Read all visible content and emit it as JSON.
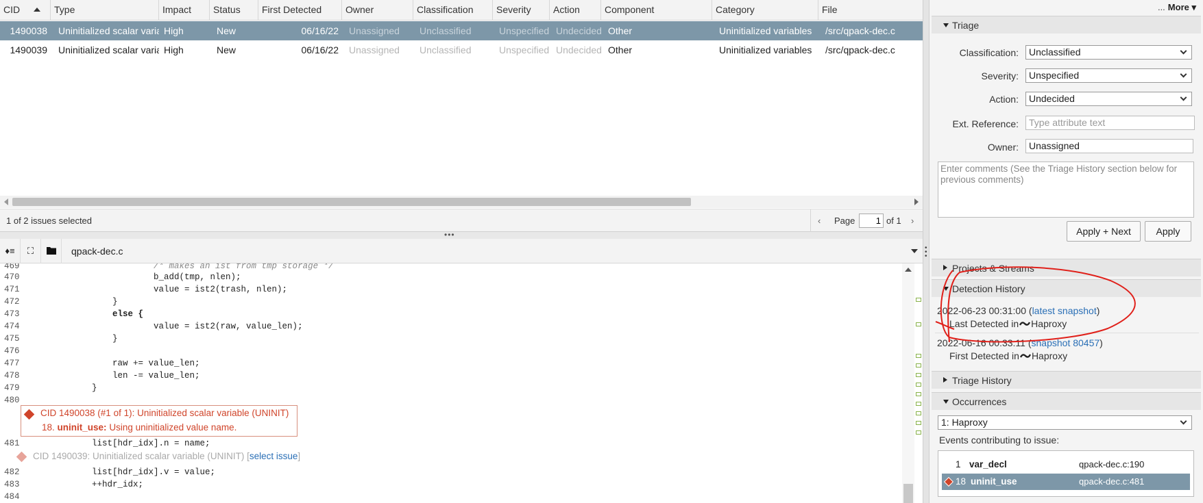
{
  "table": {
    "columns": [
      "CID",
      "Type",
      "Impact",
      "Status",
      "First Detected",
      "Owner",
      "Classification",
      "Severity",
      "Action",
      "Component",
      "Category",
      "File"
    ],
    "rows": [
      {
        "cid": "1490038",
        "type": "Uninitialized scalar variable",
        "impact": "High",
        "status": "New",
        "first_detected": "06/16/22",
        "owner": "Unassigned",
        "classification": "Unclassified",
        "severity": "Unspecified",
        "action": "Undecided",
        "component": "Other",
        "category": "Uninitialized variables",
        "file": "/src/qpack-dec.c"
      },
      {
        "cid": "1490039",
        "type": "Uninitialized scalar variable",
        "impact": "High",
        "status": "New",
        "first_detected": "06/16/22",
        "owner": "Unassigned",
        "classification": "Unclassified",
        "severity": "Unspecified",
        "action": "Undecided",
        "component": "Other",
        "category": "Uninitialized variables",
        "file": "/src/qpack-dec.c"
      }
    ],
    "selected_count": "1 of 2 issues selected",
    "pager": {
      "prev": "‹",
      "page_label": "Page",
      "page": "1",
      "of_label": "of 1",
      "next": "›"
    }
  },
  "file_bar": {
    "file_name": "qpack-dec.c"
  },
  "code": {
    "lines": [
      {
        "n": "469",
        "text": "                        /* makes an ist from tmp storage */"
      },
      {
        "n": "470",
        "text": "                        b_add(tmp, nlen);"
      },
      {
        "n": "471",
        "text": "                        value = ist2(trash, nlen);"
      },
      {
        "n": "472",
        "text": "                }"
      },
      {
        "n": "473",
        "text": "                else {"
      },
      {
        "n": "474",
        "text": "                        value = ist2(raw, value_len);"
      },
      {
        "n": "475",
        "text": "                }"
      },
      {
        "n": "476",
        "text": ""
      },
      {
        "n": "477",
        "text": "                raw += value_len;"
      },
      {
        "n": "478",
        "text": "                len -= value_len;"
      },
      {
        "n": "479",
        "text": "            }"
      },
      {
        "n": "480",
        "text": ""
      },
      {
        "n": "481",
        "text": "            list[hdr_idx].n = name;"
      },
      {
        "n": "482",
        "text": "            list[hdr_idx].v = value;"
      },
      {
        "n": "483",
        "text": "            ++hdr_idx;"
      },
      {
        "n": "484",
        "text": ""
      }
    ],
    "event": {
      "title": "CID 1490038 (#1 of 1): Uninitialized scalar variable (UNINIT)",
      "step": "18.",
      "event_name": "uninit_use:",
      "message": "Using uninitialized value name."
    },
    "other_issue": {
      "text": "CID 1490039: Uninitialized scalar variable (UNINIT) [",
      "link": "select issue",
      "close": "]"
    }
  },
  "right": {
    "more": "More",
    "more_dots": "...",
    "triage": {
      "title": "Triage",
      "classification_label": "Classification:",
      "classification": "Unclassified",
      "severity_label": "Severity:",
      "severity": "Unspecified",
      "action_label": "Action:",
      "action": "Undecided",
      "ext_ref_label": "Ext. Reference:",
      "ext_ref_placeholder": "Type attribute text",
      "owner_label": "Owner:",
      "owner": "Unassigned",
      "comments_placeholder": "Enter comments (See the Triage History section below for previous comments)",
      "apply_next": "Apply + Next",
      "apply": "Apply"
    },
    "projects_title": "Projects & Streams",
    "detection": {
      "title": "Detection History",
      "entries": [
        {
          "date": "2022-06-23 00:31:00 (",
          "link": "latest snapshot",
          "close": ")",
          "sub_prefix": "Last Detected in",
          "stream": "Haproxy"
        },
        {
          "date": "2022-06-16 00:33:11 (",
          "link": "snapshot 80457",
          "close": ")",
          "sub_prefix": "First Detected in",
          "stream": "Haproxy"
        }
      ]
    },
    "triage_history_title": "Triage History",
    "occurrences": {
      "title": "Occurrences",
      "selected": "1: Haproxy",
      "events_label": "Events contributing to issue:",
      "events": [
        {
          "num": "1",
          "name": "var_decl",
          "loc": "qpack-dec.c:190"
        },
        {
          "num": "18",
          "name": "uninit_use",
          "loc": "qpack-dec.c:481"
        }
      ]
    }
  },
  "colors": {
    "selected_row": "#7d97a8",
    "event_red": "#d0442a",
    "link_blue": "#2a6fb6",
    "annotation_red": "#e0201a"
  }
}
